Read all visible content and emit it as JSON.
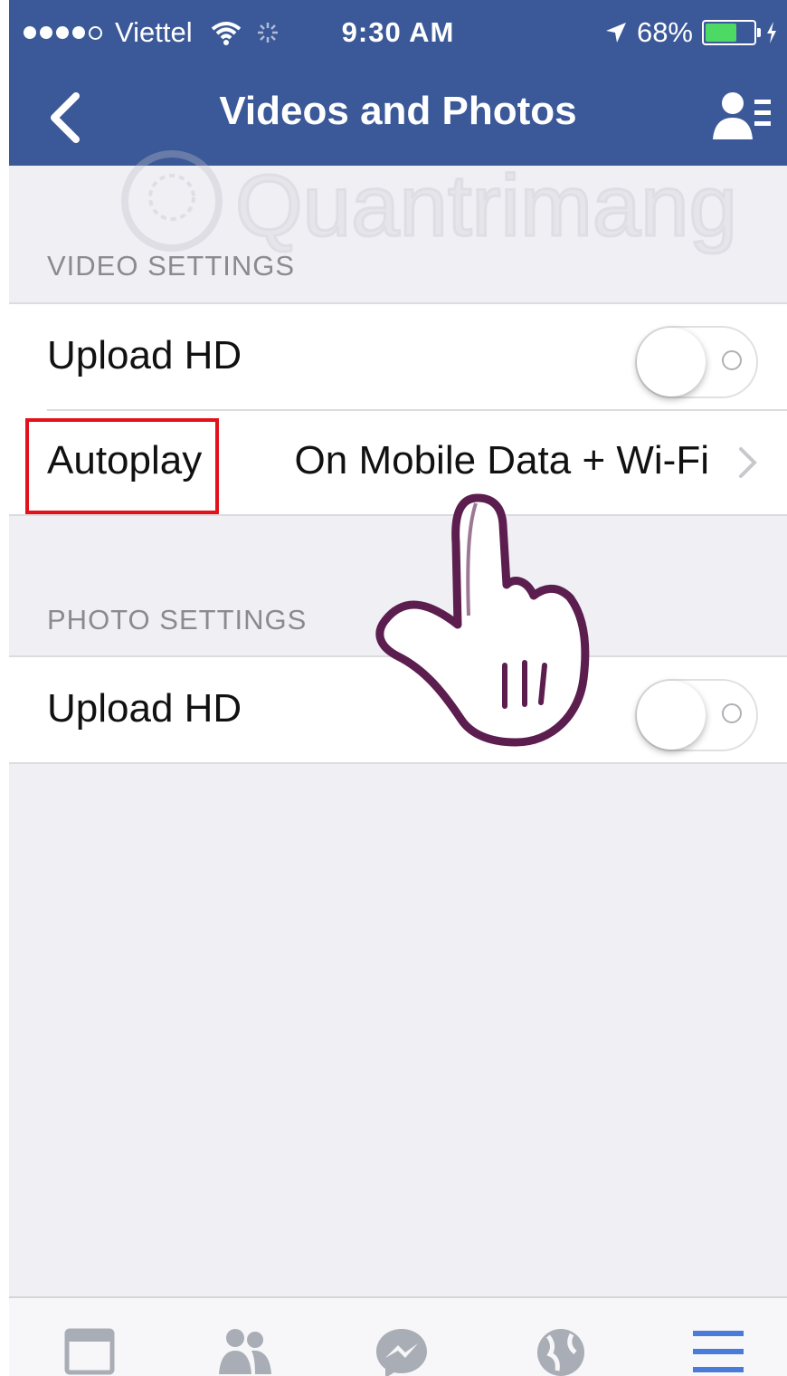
{
  "status_bar": {
    "carrier": "Viettel",
    "time": "9:30 AM",
    "battery_percent_label": "68%",
    "battery_level": 0.68,
    "signal_bars": 4,
    "signal_max": 5
  },
  "nav": {
    "title": "Videos and Photos",
    "back_icon": "chevron-left-icon",
    "right_icon": "profile-list-icon"
  },
  "watermark": "Quantrimang",
  "video_settings": {
    "header": "VIDEO SETTINGS",
    "upload_hd_label": "Upload HD",
    "upload_hd_on": false,
    "autoplay_label": "Autoplay",
    "autoplay_value": "On Mobile Data + Wi-Fi"
  },
  "photo_settings": {
    "header": "PHOTO SETTINGS",
    "upload_hd_label": "Upload HD",
    "upload_hd_on": false
  },
  "tabs": [
    {
      "name": "news-feed",
      "icon": "news-feed-icon"
    },
    {
      "name": "friends",
      "icon": "friends-icon"
    },
    {
      "name": "messenger",
      "icon": "messenger-icon"
    },
    {
      "name": "notifications",
      "icon": "globe-icon"
    },
    {
      "name": "more",
      "icon": "menu-icon",
      "active": true
    }
  ],
  "colors": {
    "brand": "#3b5998",
    "highlight": "#e3121a",
    "active_tab": "#4a7bd8",
    "inactive_tab": "#a9adb5",
    "battery": "#4cd964"
  }
}
